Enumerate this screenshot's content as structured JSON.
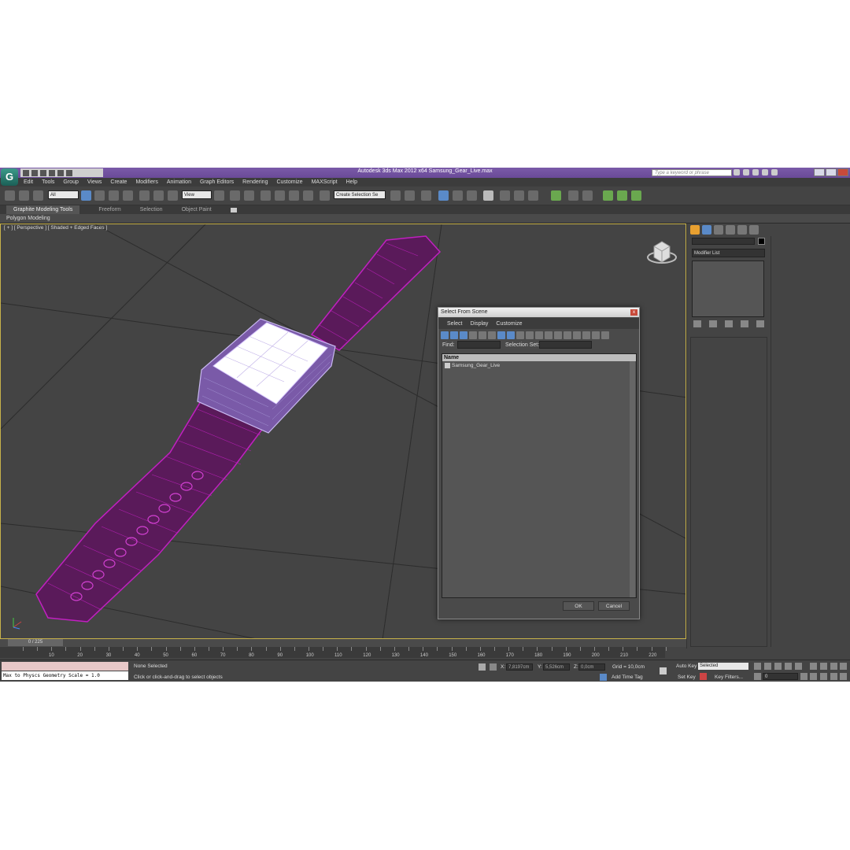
{
  "window": {
    "title": "Autodesk 3ds Max  2012 x64      Samsung_Gear_Live.max",
    "search_placeholder": "Type a keyword or phrase",
    "logo": "G"
  },
  "menu": [
    "Edit",
    "Tools",
    "Group",
    "Views",
    "Create",
    "Modifiers",
    "Animation",
    "Graph Editors",
    "Rendering",
    "Customize",
    "MAXScript",
    "Help"
  ],
  "toolbar": {
    "filter": "All",
    "ref_coord": "View",
    "selection_set": "Create Selection Se"
  },
  "ribbon": {
    "tabs": [
      "Graphite Modeling Tools",
      "Freeform",
      "Selection",
      "Object Paint"
    ],
    "panel": "Polygon Modeling"
  },
  "viewport": {
    "label": "[ + ] [ Perspective ] [ Shaded + Edged Faces ]"
  },
  "command_panel": {
    "modifier_list": "Modifier List"
  },
  "dialog": {
    "title": "Select From Scene",
    "close": "x",
    "menu": [
      "Select",
      "Display",
      "Customize"
    ],
    "find_label": "Find:",
    "selection_set_label": "Selection Set:",
    "column_header": "Name",
    "items": [
      "Samsung_Gear_Live"
    ],
    "ok": "OK",
    "cancel": "Cancel"
  },
  "timeline": {
    "frame": "0 / 225",
    "ticks": [
      "10",
      "20",
      "30",
      "40",
      "50",
      "60",
      "70",
      "80",
      "90",
      "100",
      "110",
      "120",
      "130",
      "140",
      "150",
      "160",
      "170",
      "180",
      "190",
      "200",
      "210",
      "220"
    ]
  },
  "status": {
    "listener": "Max to Physcs Geometry Scale = 1.0",
    "selection": "None Selected",
    "prompt": "Click or click-and-drag to select objects",
    "x_label": "X:",
    "x_value": "7,8197cm",
    "y_label": "Y:",
    "y_value": "5,526cm",
    "z_label": "Z:",
    "z_value": "0,0cm",
    "grid": "Grid = 10,0cm",
    "add_time_tag": "Add Time Tag",
    "auto_key": "Auto Key",
    "auto_key_mode": "Selected",
    "set_key": "Set Key",
    "key_filters": "Key Filters...",
    "current_frame": "0"
  }
}
